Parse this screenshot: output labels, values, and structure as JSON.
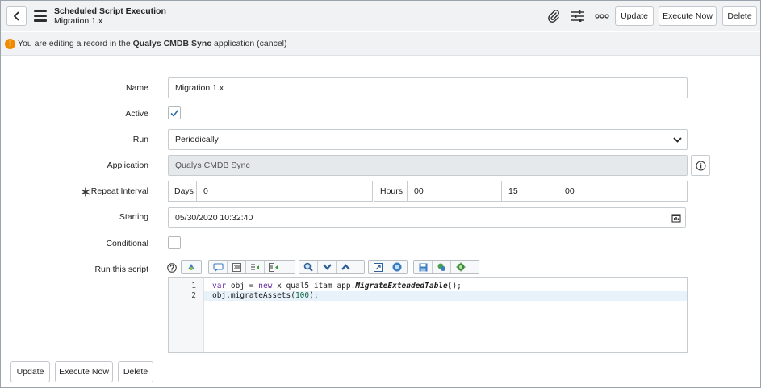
{
  "header": {
    "title": "Scheduled Script Execution",
    "subtitle": "Migration 1.x",
    "update_label": "Update",
    "execute_label": "Execute Now",
    "delete_label": "Delete"
  },
  "notice": {
    "prefix": "You are editing a record in the",
    "app_name": "Qualys CMDB Sync",
    "suffix": "application",
    "cancel": "(cancel)"
  },
  "form": {
    "name_label": "Name",
    "name_value": "Migration 1.x",
    "active_label": "Active",
    "active_checked": true,
    "run_label": "Run",
    "run_value": "Periodically",
    "application_label": "Application",
    "application_value": "Qualys CMDB Sync",
    "repeat_label": "Repeat Interval",
    "days_label": "Days",
    "days_value": "0",
    "hours_label": "Hours",
    "hours_value": "00",
    "minutes_value": "15",
    "seconds_value": "00",
    "starting_label": "Starting",
    "starting_value": "05/30/2020 10:32:40",
    "conditional_label": "Conditional",
    "conditional_checked": false,
    "script_label": "Run this script"
  },
  "script": {
    "line1_no": "1",
    "line2_no": "2",
    "l1_kw": "var",
    "l1_a": " obj = ",
    "l1_new": "new",
    "l1_b": " x_qual5_itam_app.",
    "l1_fn": "MigrateExtendedTable",
    "l1_c": "();",
    "l2_a": "obj.migrateAssets(",
    "l2_num": "100",
    "l2_b": ");"
  },
  "footer": {
    "update_label": "Update",
    "execute_label": "Execute Now",
    "delete_label": "Delete"
  },
  "colors": {
    "accent": "#2e6ea8",
    "warning": "#f08a00",
    "header_bg": "#f1f2f4"
  },
  "icons": [
    "chevron-left-icon",
    "menu-icon",
    "paperclip-icon",
    "sliders-icon",
    "more-icon",
    "warning-icon",
    "check-icon",
    "dropdown-icon",
    "info-icon",
    "asterisk-icon",
    "calendar-icon",
    "help-icon"
  ]
}
